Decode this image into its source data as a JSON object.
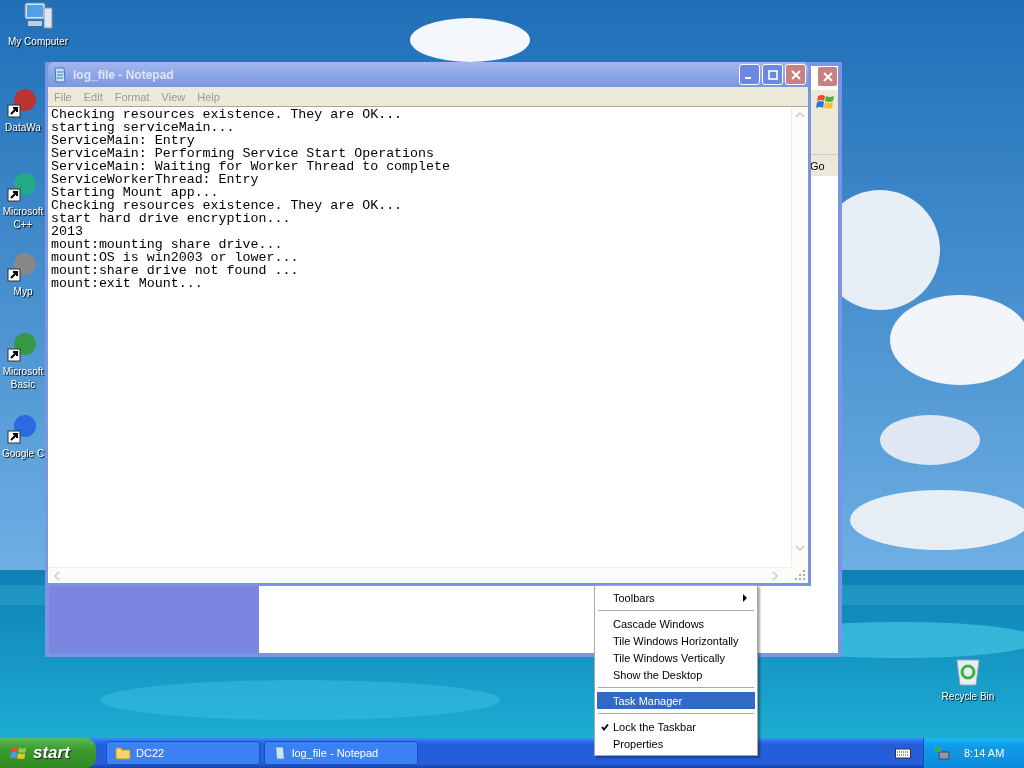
{
  "desktop_icons": [
    {
      "label": "My Computer",
      "kind": "computer"
    },
    {
      "label": "DataWa",
      "kind": "shortcut"
    },
    {
      "label": "Microsoft C++",
      "kind": "shortcut"
    },
    {
      "label": "Myp",
      "kind": "shortcut"
    },
    {
      "label": "Microsoft Basic",
      "kind": "shortcut"
    },
    {
      "label": "Google C",
      "kind": "shortcut"
    },
    {
      "label": "Recycle Bin",
      "kind": "recycle"
    }
  ],
  "back_window": {
    "go_button": "Go"
  },
  "notepad": {
    "title": "log_file - Notepad",
    "menu": [
      "File",
      "Edit",
      "Format",
      "View",
      "Help"
    ],
    "text_lines": [
      "Checking resources existence. They are OK...",
      "starting serviceMain...",
      "ServiceMain: Entry",
      "ServiceMain: Performing Service Start Operations",
      "ServiceMain: Waiting for Worker Thread to complete",
      "ServiceWorkerThread: Entry",
      "Starting Mount app...",
      "Checking resources existence. They are OK...",
      "start hard drive encryption...",
      "2013",
      "mount:mounting share drive...",
      "mount:OS is win2003 or lower...",
      "mount:share drive not found ...",
      "mount:exit Mount..."
    ]
  },
  "context_menu": {
    "groups": [
      [
        {
          "label": "Toolbars",
          "submenu": true,
          "selected": false,
          "checked": false
        }
      ],
      [
        {
          "label": "Cascade Windows",
          "submenu": false,
          "selected": false,
          "checked": false
        },
        {
          "label": "Tile Windows Horizontally",
          "submenu": false,
          "selected": false,
          "checked": false
        },
        {
          "label": "Tile Windows Vertically",
          "submenu": false,
          "selected": false,
          "checked": false
        },
        {
          "label": "Show the Desktop",
          "submenu": false,
          "selected": false,
          "checked": false
        }
      ],
      [
        {
          "label": "Task Manager",
          "submenu": false,
          "selected": true,
          "checked": false
        }
      ],
      [
        {
          "label": "Lock the Taskbar",
          "submenu": false,
          "selected": false,
          "checked": true
        },
        {
          "label": "Properties",
          "submenu": false,
          "selected": false,
          "checked": false
        }
      ]
    ]
  },
  "taskbar": {
    "start": "start",
    "buttons": [
      {
        "label": "DC22",
        "kind": "folder"
      },
      {
        "label": "log_file - Notepad",
        "kind": "notepad"
      }
    ],
    "clock": "8:14 AM"
  }
}
